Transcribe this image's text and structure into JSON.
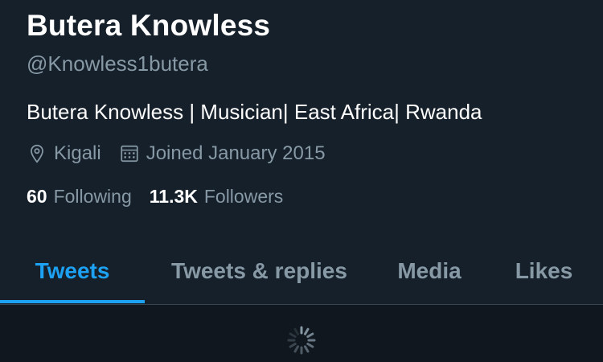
{
  "profile": {
    "display_name": "Butera Knowless",
    "handle": "@Knowless1butera",
    "bio": "Butera Knowless | Musician| East Africa| Rwanda",
    "location": "Kigali",
    "location_icon": "location-pin-icon",
    "joined": "Joined January 2015",
    "joined_icon": "calendar-icon",
    "following_count": "60",
    "following_label": "Following",
    "followers_count": "11.3K",
    "followers_label": "Followers"
  },
  "tabs": [
    {
      "label": "Tweets",
      "active": true
    },
    {
      "label": "Tweets & replies",
      "active": false
    },
    {
      "label": "Media",
      "active": false
    },
    {
      "label": "Likes",
      "active": false
    }
  ],
  "feed": {
    "loading_icon": "loading-spinner-icon"
  },
  "colors": {
    "background": "#15202b",
    "accent": "#1da1f2",
    "secondary_text": "#8899a6"
  }
}
